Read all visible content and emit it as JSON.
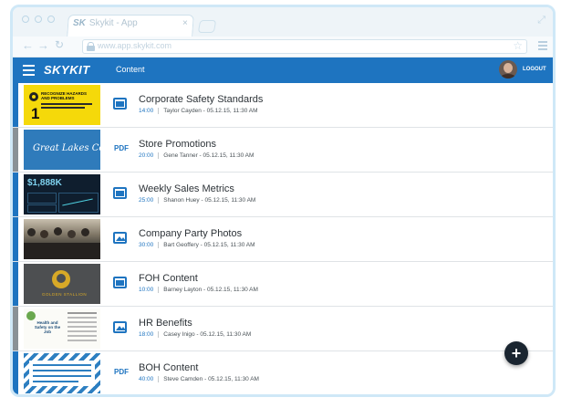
{
  "browser": {
    "tab_title": "Skykit - App",
    "tab_logo": "SK",
    "url": "www.app.skykit.com"
  },
  "appbar": {
    "logo": "SKYKIT",
    "section": "Content",
    "logout": "LOGOUT",
    "accent": "#1e74c0"
  },
  "rows": [
    {
      "type": "slide",
      "title": "Corporate Safety Standards",
      "duration": "14:00",
      "author": "Taylor Cayden",
      "date": "05.12.15, 11:30 AM",
      "thumb_heading": "RECOGNIZE HAZARDS AND PROBLEMS",
      "thumb_number": "1",
      "edge": "#1e74c0"
    },
    {
      "type": "pdf",
      "title": "Store Promotions",
      "duration": "20:00",
      "author": "Gene Tanner",
      "date": "05.12.15, 11:30 AM",
      "thumb_heading": "Great Lakes Co.",
      "edge": "#8a9196"
    },
    {
      "type": "slide",
      "title": "Weekly Sales Metrics",
      "duration": "25:00",
      "author": "Shanon Huey",
      "date": "05.12.15, 11:30 AM",
      "thumb_heading": "$1,888K",
      "edge": "#1e74c0"
    },
    {
      "type": "image",
      "title": "Company Party Photos",
      "duration": "30:00",
      "author": "Bart Geoffery",
      "date": "05.12.15, 11:30 AM",
      "edge": "#1e74c0"
    },
    {
      "type": "slide",
      "title": "FOH Content",
      "duration": "10:00",
      "author": "Barney Layton",
      "date": "05.12.15, 11:30 AM",
      "thumb_heading": "GOLDEN STALLION",
      "edge": "#1e74c0"
    },
    {
      "type": "image",
      "title": "HR Benefits",
      "duration": "18:00",
      "author": "Casey Inigo",
      "date": "05.12.15, 11:30 AM",
      "thumb_heading": "Health and Safety on the Job",
      "edge": "#8a9196"
    },
    {
      "type": "pdf",
      "title": "BOH Content",
      "duration": "40:00",
      "author": "Steve Camden",
      "date": "05.12.15, 11:30 AM",
      "edge": "#1e74c0"
    }
  ],
  "pdf_label": "PDF",
  "fab_label": "+"
}
